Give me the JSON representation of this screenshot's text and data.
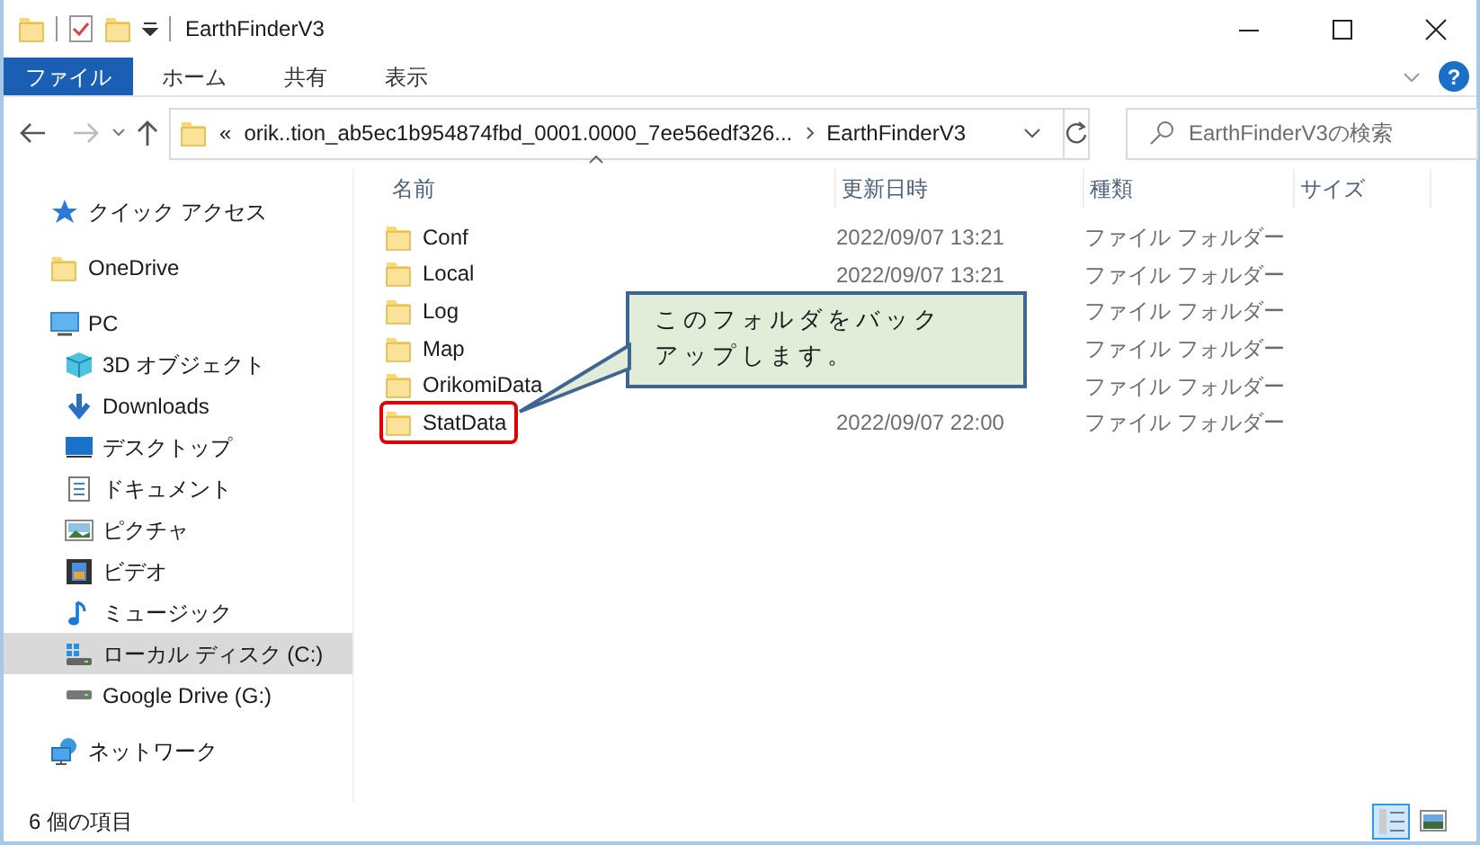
{
  "window": {
    "title": "EarthFinderV3"
  },
  "ribbon": {
    "tabs": [
      {
        "label": "ファイル",
        "kind": "file"
      },
      {
        "label": "ホーム",
        "kind": "tab"
      },
      {
        "label": "共有",
        "kind": "tab"
      },
      {
        "label": "表示",
        "kind": "tab"
      }
    ],
    "help": "?"
  },
  "address": {
    "overflow": "«",
    "segments": [
      "orik..tion_ab5ec1b954874fbd_0001.0000_7ee56edf326...",
      "EarthFinderV3"
    ]
  },
  "search": {
    "placeholder": "EarthFinderV3の検索"
  },
  "sidebar": {
    "items": [
      {
        "label": "クイック アクセス",
        "kind": "star",
        "selected": false
      },
      {
        "label": "OneDrive",
        "kind": "folder",
        "selected": false
      },
      {
        "label": "PC",
        "kind": "pc",
        "selected": false,
        "children": [
          {
            "label": "3D オブジェクト",
            "kind": "cube",
            "selected": false
          },
          {
            "label": "Downloads",
            "kind": "download",
            "selected": false
          },
          {
            "label": "デスクトップ",
            "kind": "desktop",
            "selected": false
          },
          {
            "label": "ドキュメント",
            "kind": "document",
            "selected": false
          },
          {
            "label": "ピクチャ",
            "kind": "image",
            "selected": false
          },
          {
            "label": "ビデオ",
            "kind": "video",
            "selected": false
          },
          {
            "label": "ミュージック",
            "kind": "music",
            "selected": false
          },
          {
            "label": "ローカル ディスク (C:)",
            "kind": "drive",
            "selected": true
          },
          {
            "label": "Google Drive (G:)",
            "kind": "drive2",
            "selected": false
          }
        ]
      },
      {
        "label": "ネットワーク",
        "kind": "network",
        "selected": false
      }
    ]
  },
  "table": {
    "columns": [
      "名前",
      "更新日時",
      "種類",
      "サイズ"
    ],
    "rows": [
      {
        "name": "Conf",
        "modified": "2022/09/07 13:21",
        "type": "ファイル フォルダー",
        "highlighted": false
      },
      {
        "name": "Local",
        "modified": "2022/09/07 13:21",
        "type": "ファイル フォルダー",
        "highlighted": false
      },
      {
        "name": "Log",
        "type": "ファイル フォルダー",
        "highlighted": false
      },
      {
        "name": "Map",
        "type": "ファイル フォルダー",
        "highlighted": false
      },
      {
        "name": "OrikomiData",
        "type": "ファイル フォルダー",
        "highlighted": false
      },
      {
        "name": "StatData",
        "modified": "2022/09/07 22:00",
        "type": "ファイル フォルダー",
        "highlighted": true
      }
    ]
  },
  "callout": {
    "text": "このフォルダをバックアップします。"
  },
  "status_bar": {
    "text": "6 個の項目",
    "views": [
      {
        "kind": "details",
        "selected": true
      },
      {
        "kind": "large",
        "selected": false
      }
    ]
  }
}
